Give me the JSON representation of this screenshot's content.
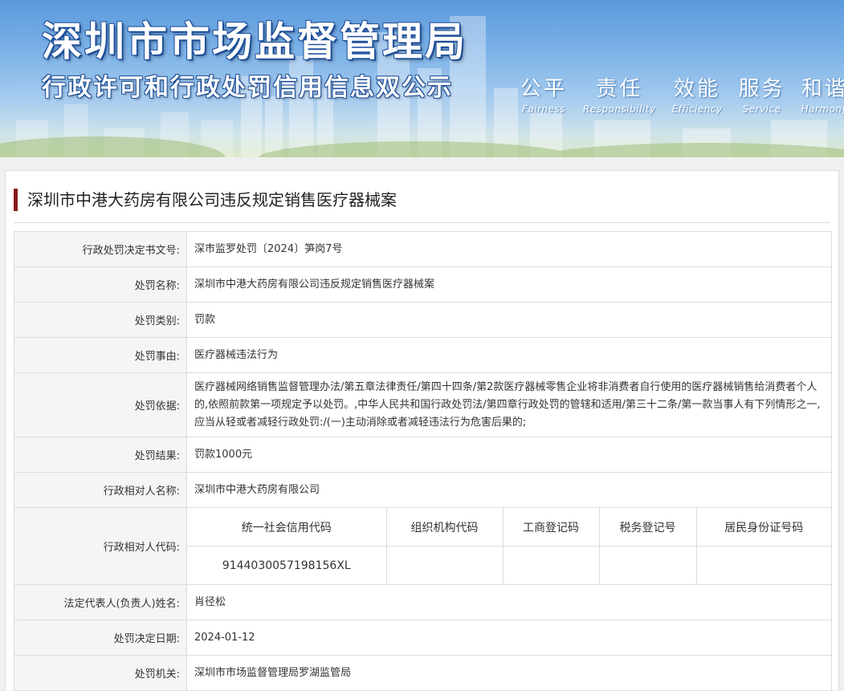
{
  "banner": {
    "title": "深圳市市场监督管理局",
    "subtitle": "行政许可和行政处罚信用信息双公示",
    "slogans": [
      {
        "cn": "公平",
        "en": "Fairness"
      },
      {
        "cn": "责任",
        "en": "Responsibility"
      },
      {
        "cn": "效能",
        "en": "Efficiency"
      },
      {
        "cn": "服务",
        "en": "Service"
      },
      {
        "cn": "和谐",
        "en": "Harmony"
      }
    ]
  },
  "case_title": "深圳市中港大药房有限公司违反规定销售医疗器械案",
  "rows": {
    "doc_no": {
      "label": "行政处罚决定书文号:",
      "value": "深市监罗处罚〔2024〕笋岗7号"
    },
    "name": {
      "label": "处罚名称:",
      "value": "深圳市中港大药房有限公司违反规定销售医疗器械案"
    },
    "category": {
      "label": "处罚类别:",
      "value": "罚款"
    },
    "reason": {
      "label": "处罚事由:",
      "value": "医疗器械违法行为"
    },
    "basis": {
      "label": "处罚依据:",
      "value": "医疗器械网络销售监督管理办法/第五章法律责任/第四十四条/第2款医疗器械零售企业将非消费者自行使用的医疗器械销售给消费者个人的,依照前款第一项规定予以处罚。,中华人民共和国行政处罚法/第四章行政处罚的管辖和适用/第三十二条/第一款当事人有下列情形之一,应当从轻或者减轻行政处罚:/(一)主动消除或者减轻违法行为危害后果的;"
    },
    "result": {
      "label": "处罚结果:",
      "value": "罚款1000元"
    },
    "party_name": {
      "label": "行政相对人名称:",
      "value": "深圳市中港大药房有限公司"
    },
    "party_code": {
      "label": "行政相对人代码:",
      "headers": [
        "统一社会信用代码",
        "组织机构代码",
        "工商登记码",
        "税务登记号",
        "居民身份证号码"
      ],
      "values": [
        "9144030057198156XL",
        "",
        "",
        "",
        ""
      ]
    },
    "legal_rep": {
      "label": "法定代表人(负责人)姓名:",
      "value": "肖径松"
    },
    "date": {
      "label": "处罚决定日期:",
      "value": "2024-01-12"
    },
    "authority": {
      "label": "处罚机关:",
      "value": "深圳市市场监督管理局罗湖监管局"
    }
  }
}
